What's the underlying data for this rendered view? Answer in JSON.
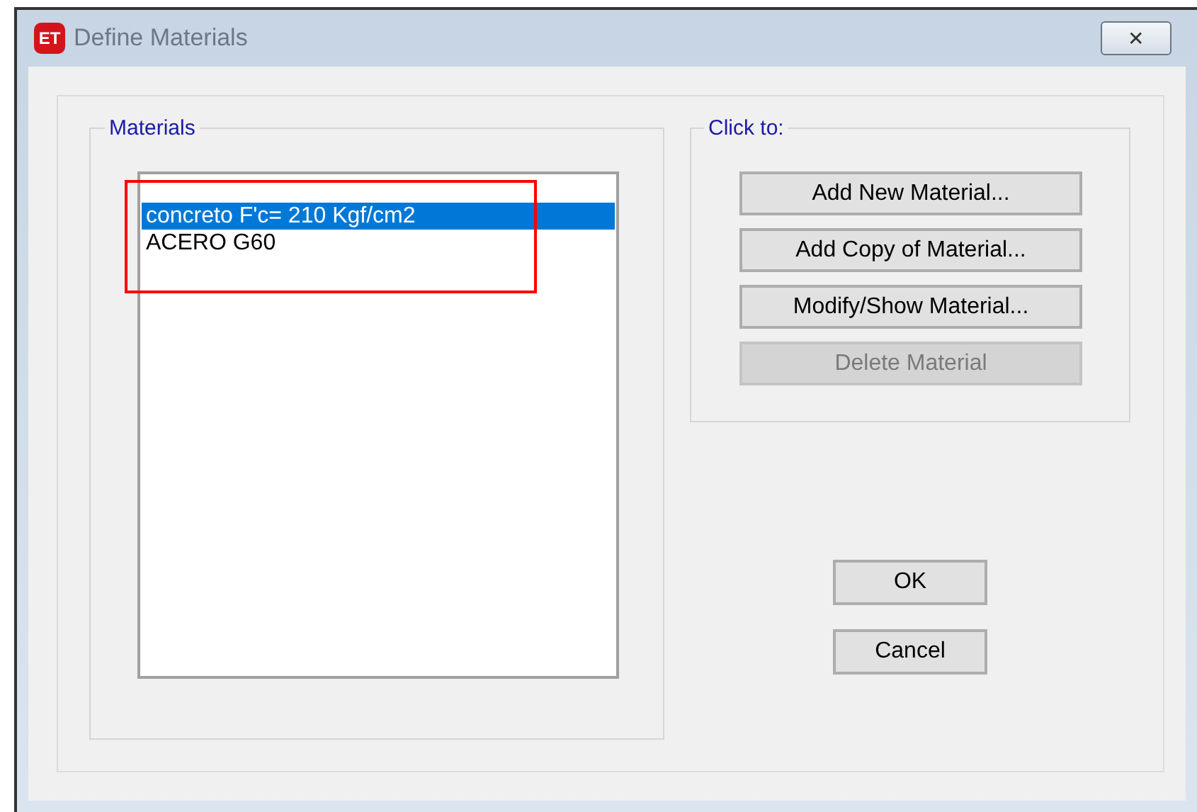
{
  "window": {
    "icon_text": "ET",
    "title": "Define Materials",
    "close": "✕"
  },
  "materials": {
    "label": "Materials",
    "items": [
      {
        "name": "concreto F'c= 210 Kgf/cm2",
        "selected": true
      },
      {
        "name": "ACERO G60",
        "selected": false
      }
    ]
  },
  "actions": {
    "label": "Click to:",
    "buttons": [
      {
        "label": "Add New Material...",
        "disabled": false
      },
      {
        "label": "Add Copy of Material...",
        "disabled": false
      },
      {
        "label": "Modify/Show Material...",
        "disabled": false
      },
      {
        "label": "Delete Material",
        "disabled": true
      }
    ]
  },
  "buttons": [
    "OK",
    "Cancel"
  ]
}
